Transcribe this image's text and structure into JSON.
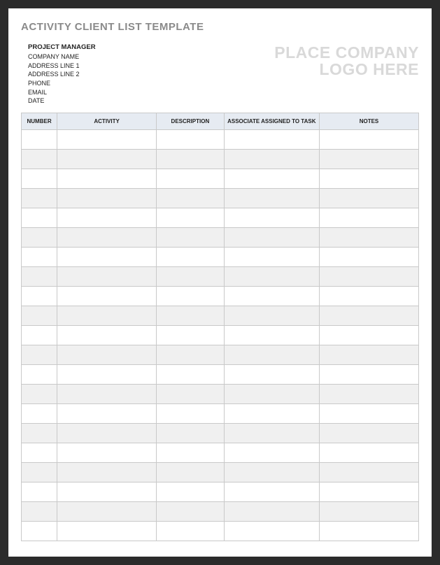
{
  "title": "ACTIVITY CLIENT LIST TEMPLATE",
  "project_manager": {
    "heading": "PROJECT MANAGER",
    "fields": [
      "COMPANY NAME",
      "ADDRESS LINE 1",
      "ADDRESS LINE 2",
      "PHONE",
      "EMAIL",
      "DATE"
    ]
  },
  "logo_placeholder": {
    "line1": "PLACE COMPANY",
    "line2": "LOGO HERE"
  },
  "table": {
    "headers": {
      "number": "NUMBER",
      "activity": "ACTIVITY",
      "description": "DESCRIPTION",
      "associate": "ASSOCIATE ASSIGNED TO TASK",
      "notes": "NOTES"
    },
    "rows": [
      {
        "number": "",
        "activity": "",
        "description": "",
        "associate": "",
        "notes": ""
      },
      {
        "number": "",
        "activity": "",
        "description": "",
        "associate": "",
        "notes": ""
      },
      {
        "number": "",
        "activity": "",
        "description": "",
        "associate": "",
        "notes": ""
      },
      {
        "number": "",
        "activity": "",
        "description": "",
        "associate": "",
        "notes": ""
      },
      {
        "number": "",
        "activity": "",
        "description": "",
        "associate": "",
        "notes": ""
      },
      {
        "number": "",
        "activity": "",
        "description": "",
        "associate": "",
        "notes": ""
      },
      {
        "number": "",
        "activity": "",
        "description": "",
        "associate": "",
        "notes": ""
      },
      {
        "number": "",
        "activity": "",
        "description": "",
        "associate": "",
        "notes": ""
      },
      {
        "number": "",
        "activity": "",
        "description": "",
        "associate": "",
        "notes": ""
      },
      {
        "number": "",
        "activity": "",
        "description": "",
        "associate": "",
        "notes": ""
      },
      {
        "number": "",
        "activity": "",
        "description": "",
        "associate": "",
        "notes": ""
      },
      {
        "number": "",
        "activity": "",
        "description": "",
        "associate": "",
        "notes": ""
      },
      {
        "number": "",
        "activity": "",
        "description": "",
        "associate": "",
        "notes": ""
      },
      {
        "number": "",
        "activity": "",
        "description": "",
        "associate": "",
        "notes": ""
      },
      {
        "number": "",
        "activity": "",
        "description": "",
        "associate": "",
        "notes": ""
      },
      {
        "number": "",
        "activity": "",
        "description": "",
        "associate": "",
        "notes": ""
      },
      {
        "number": "",
        "activity": "",
        "description": "",
        "associate": "",
        "notes": ""
      },
      {
        "number": "",
        "activity": "",
        "description": "",
        "associate": "",
        "notes": ""
      },
      {
        "number": "",
        "activity": "",
        "description": "",
        "associate": "",
        "notes": ""
      },
      {
        "number": "",
        "activity": "",
        "description": "",
        "associate": "",
        "notes": ""
      },
      {
        "number": "",
        "activity": "",
        "description": "",
        "associate": "",
        "notes": ""
      }
    ]
  }
}
